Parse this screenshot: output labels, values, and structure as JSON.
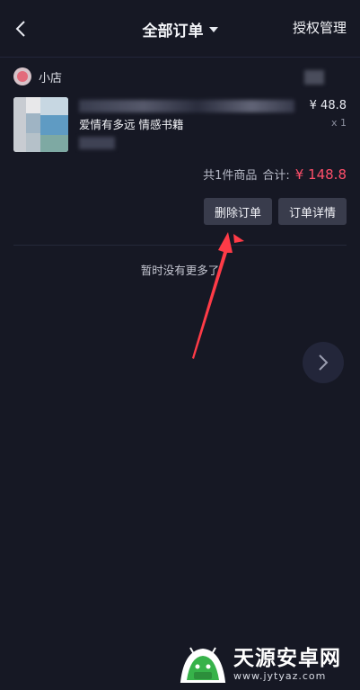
{
  "header": {
    "title": "全部订单",
    "right_link": "授权管理"
  },
  "order": {
    "shop_name": "小店",
    "product_subtitle": "爱情有多远 情感书籍",
    "unit_price": "¥ 48.8",
    "quantity": "x 1",
    "summary_count": "共1件商品",
    "summary_total_label": "合计:",
    "total_amount": "¥ 148.8",
    "delete_label": "删除订单",
    "detail_label": "订单详情"
  },
  "list": {
    "end_text": "暂时没有更多了"
  },
  "colors": {
    "background": "#161824",
    "button": "#393c4c",
    "price_accent": "#ff4f6a",
    "annotation_arrow": "#ff3b47",
    "watermark_green": "#37b24a"
  },
  "icons": {
    "back": "chevron-left-icon",
    "title_caret": "caret-down-icon",
    "next": "chevron-right-icon",
    "arrow": "red-arrow-annotation"
  },
  "watermark": {
    "name": "天源安卓网",
    "url": "www.jytyaz.com"
  }
}
